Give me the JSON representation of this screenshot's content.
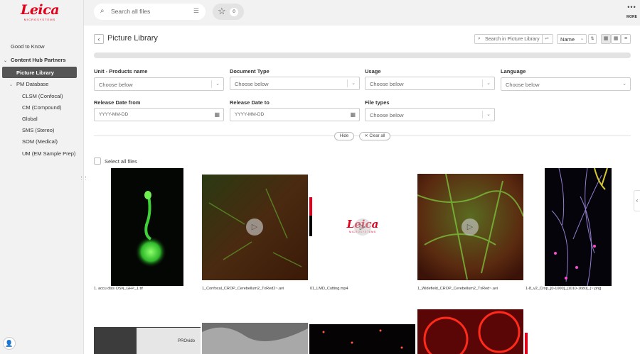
{
  "brand": {
    "logo_text": "Leica",
    "logo_sub": "MICROSYSTEMS",
    "accent": "#e2001a"
  },
  "topbar": {
    "search_placeholder": "Search all files",
    "favorites_count": "0",
    "more_label": "MORE"
  },
  "sidebar": {
    "good_to_know": "Good to Know",
    "content_hub": "Content Hub Partners",
    "picture_library": "Picture Library",
    "pm_database": "PM Database",
    "items": [
      "CLSM (Confocal)",
      "CM (Compound)",
      "Global",
      "SMS (Stereo)",
      "SOM (Medical)",
      "UM (EM Sample Prep)"
    ]
  },
  "header": {
    "title": "Picture Library",
    "search_placeholder": "Search in Picture Library",
    "sort_value": "Name"
  },
  "filters": {
    "unit_label": "Unit - Products name",
    "unit_value": "Choose below",
    "doctype_label": "Document Type",
    "doctype_value": "Choose below",
    "usage_label": "Usage",
    "usage_value": "Choose below",
    "language_label": "Language",
    "language_value": "Choose below",
    "date_from_label": "Release Date from",
    "date_from_ph": "YYYY-MM-DD",
    "date_to_label": "Release Date to",
    "date_to_ph": "YYYY-MM-DD",
    "filetypes_label": "File types",
    "filetypes_value": "Choose below",
    "hide": "Hide",
    "clear_all": "Clear all"
  },
  "select_all": "Select all files",
  "files": [
    "1. accu diss OSN_GFP_1.tif",
    "1_Confocal_CROP_Cerebellum2_TxRed2~.avi",
    "01_LMD_Cutting.mp4",
    "1_Widefield_CROP_Cerebellum2_TxRed~.avi",
    "1-8_v2_Crop_[0-1000]_[1010-1680]_(~.png"
  ],
  "second_row_label": "PROvido"
}
